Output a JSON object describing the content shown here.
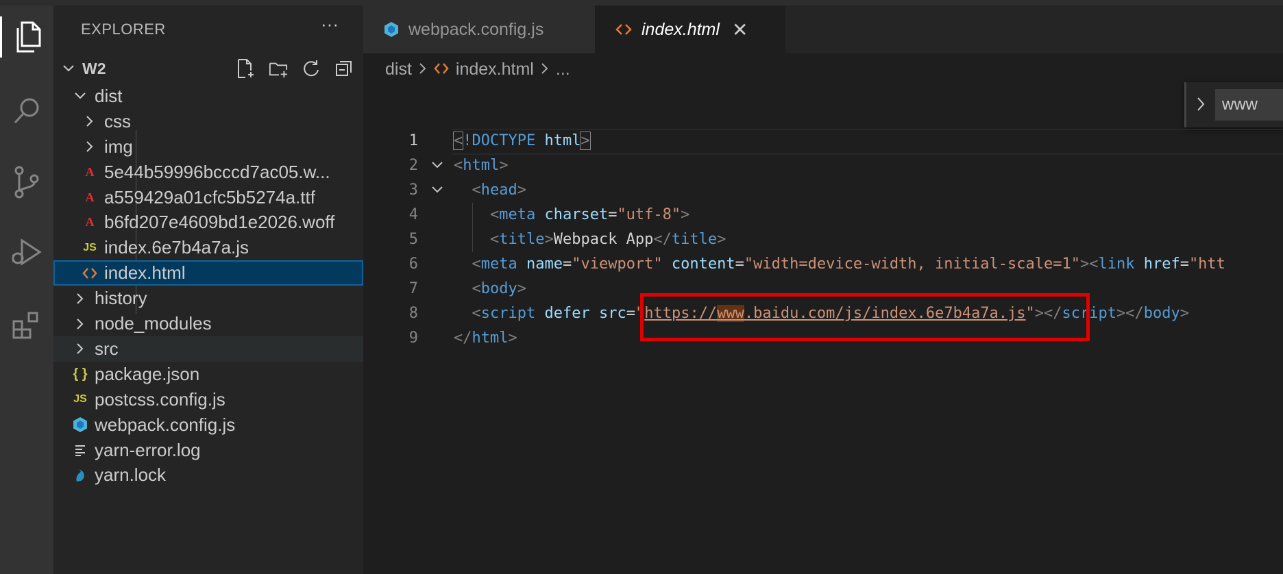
{
  "activity_bar": {
    "items": [
      "explorer-icon",
      "search-icon",
      "source-control-icon",
      "run-debug-icon",
      "extensions-icon"
    ]
  },
  "sidebar": {
    "title": "EXPLORER",
    "more": "···",
    "root": "W2",
    "items": [
      {
        "label": "dist",
        "type": "folder-open",
        "depth": 1
      },
      {
        "label": "css",
        "type": "folder",
        "depth": 2
      },
      {
        "label": "img",
        "type": "folder",
        "depth": 2
      },
      {
        "label": "5e44b59996bcccd7ac05.w...",
        "type": "font",
        "depth": 2
      },
      {
        "label": "a559429a01cfc5b5274a.ttf",
        "type": "font",
        "depth": 2
      },
      {
        "label": "b6fd207e4609bd1e2026.woff",
        "type": "font",
        "depth": 2
      },
      {
        "label": "index.6e7b4a7a.js",
        "type": "js",
        "depth": 2
      },
      {
        "label": "index.html",
        "type": "html",
        "depth": 2,
        "selected": true
      },
      {
        "label": "history",
        "type": "folder",
        "depth": 1
      },
      {
        "label": "node_modules",
        "type": "folder",
        "depth": 1
      },
      {
        "label": "src",
        "type": "folder",
        "depth": 1,
        "hover": true
      },
      {
        "label": "package.json",
        "type": "json",
        "depth": 1
      },
      {
        "label": "postcss.config.js",
        "type": "js",
        "depth": 1
      },
      {
        "label": "webpack.config.js",
        "type": "webpack",
        "depth": 1
      },
      {
        "label": "yarn-error.log",
        "type": "log",
        "depth": 1
      },
      {
        "label": "yarn.lock",
        "type": "yarn",
        "depth": 1
      }
    ]
  },
  "tabs": [
    {
      "label": "webpack.config.js",
      "active": false
    },
    {
      "label": "index.html",
      "active": true,
      "close": "✕"
    }
  ],
  "breadcrumb": {
    "folder": "dist",
    "file": "index.html",
    "more": "..."
  },
  "find_widget": {
    "value": "www"
  },
  "editor": {
    "line_numbers": [
      "1",
      "2",
      "3",
      "4",
      "5",
      "6",
      "7",
      "8",
      "9"
    ],
    "lines": [
      [
        [
          "bracket",
          "<"
        ],
        [
          "tag",
          "!DOCTYPE"
        ],
        [
          "txt",
          " "
        ],
        [
          "attr",
          "html"
        ],
        [
          "bracket",
          ">"
        ]
      ],
      [
        [
          "br",
          "<"
        ],
        [
          "tag",
          "html"
        ],
        [
          "br",
          ">"
        ]
      ],
      [
        [
          "txt",
          "  "
        ],
        [
          "br",
          "<"
        ],
        [
          "tag",
          "head"
        ],
        [
          "br",
          ">"
        ]
      ],
      [
        [
          "txt",
          "    "
        ],
        [
          "br",
          "<"
        ],
        [
          "tag",
          "meta"
        ],
        [
          "txt",
          " "
        ],
        [
          "attr",
          "charset"
        ],
        [
          "txt",
          "="
        ],
        [
          "str",
          "\"utf-8\""
        ],
        [
          "br",
          ">"
        ]
      ],
      [
        [
          "txt",
          "    "
        ],
        [
          "br",
          "<"
        ],
        [
          "tag",
          "title"
        ],
        [
          "br",
          ">"
        ],
        [
          "txt",
          "Webpack App"
        ],
        [
          "br",
          "</"
        ],
        [
          "tag",
          "title"
        ],
        [
          "br",
          ">"
        ]
      ],
      [
        [
          "txt",
          "  "
        ],
        [
          "br",
          "<"
        ],
        [
          "tag",
          "meta"
        ],
        [
          "txt",
          " "
        ],
        [
          "attr",
          "name"
        ],
        [
          "txt",
          "="
        ],
        [
          "str",
          "\"viewport\""
        ],
        [
          "txt",
          " "
        ],
        [
          "attr",
          "content"
        ],
        [
          "txt",
          "="
        ],
        [
          "str",
          "\"width=device-width, initial-scale=1\""
        ],
        [
          "br",
          "><"
        ],
        [
          "tag",
          "link"
        ],
        [
          "txt",
          " "
        ],
        [
          "attr",
          "href"
        ],
        [
          "txt",
          "="
        ],
        [
          "str",
          "\"htt"
        ]
      ],
      [
        [
          "txt",
          "  "
        ],
        [
          "br",
          "<"
        ],
        [
          "tag",
          "body"
        ],
        [
          "br",
          ">"
        ]
      ],
      [
        [
          "txt",
          "  "
        ],
        [
          "br",
          "<"
        ],
        [
          "tag",
          "script"
        ],
        [
          "txt",
          " "
        ],
        [
          "attr",
          "defer"
        ],
        [
          "txt",
          " "
        ],
        [
          "attr",
          "src"
        ],
        [
          "txt",
          "="
        ],
        [
          "str",
          "\""
        ],
        [
          "ustr",
          "https://"
        ],
        [
          "hstr",
          "www"
        ],
        [
          "ustr",
          ".baidu.com/js/index.6e7b4a7a.js"
        ],
        [
          "str",
          "\""
        ],
        [
          "br",
          "></"
        ],
        [
          "tag",
          "script"
        ],
        [
          "br",
          "></"
        ],
        [
          "tag",
          "body"
        ],
        [
          "br",
          ">"
        ]
      ],
      [
        [
          "br",
          "</"
        ],
        [
          "tag",
          "html"
        ],
        [
          "br",
          ">"
        ]
      ]
    ]
  },
  "colors": {
    "editor_bg": "#1e1e1e",
    "sidebar_bg": "#252526",
    "selection": "#04395e",
    "highlight_box": "#e00000"
  }
}
